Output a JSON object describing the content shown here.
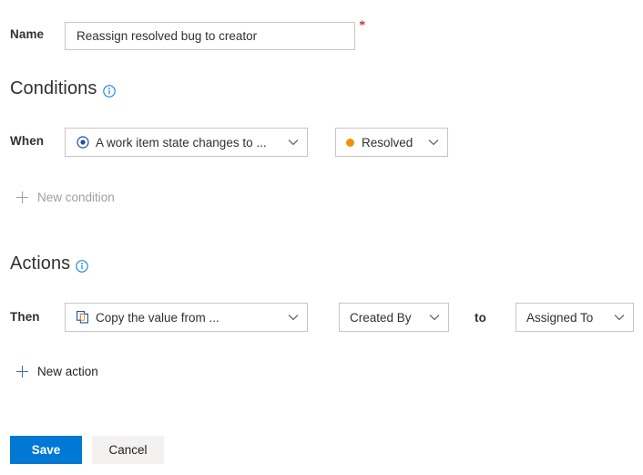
{
  "form": {
    "name_field": {
      "label": "Name",
      "value": "Reassign resolved bug to creator",
      "placeholder": "",
      "required_marker": "*"
    }
  },
  "conditions": {
    "heading": "Conditions",
    "info_icon": "info-icon",
    "when_label": "When",
    "event_dropdown": {
      "value": "A work item state changes to ...",
      "icon": "state-change-icon",
      "chevron": "chevron-down-icon"
    },
    "state_dropdown": {
      "value": "Resolved",
      "dot_color": "#f2900d",
      "chevron": "chevron-down-icon"
    },
    "new_condition_label": "New condition",
    "new_condition_enabled": false
  },
  "actions": {
    "heading": "Actions",
    "info_icon": "info-icon",
    "then_label": "Then",
    "action_dropdown": {
      "value": "Copy the value from ...",
      "icon": "copy-icon",
      "chevron": "chevron-down-icon"
    },
    "from_dropdown": {
      "value": "Created By",
      "chevron": "chevron-down-icon"
    },
    "to_label": "to",
    "to_dropdown": {
      "value": "Assigned To",
      "chevron": "chevron-down-icon"
    },
    "new_action_label": "New action",
    "new_action_enabled": true
  },
  "footer": {
    "save_label": "Save",
    "cancel_label": "Cancel"
  },
  "colors": {
    "accent": "#0078d4",
    "required": "#a80000",
    "status_resolved": "#f2900d",
    "border": "#c8c6c4",
    "disabled_text": "#a19f9d"
  }
}
